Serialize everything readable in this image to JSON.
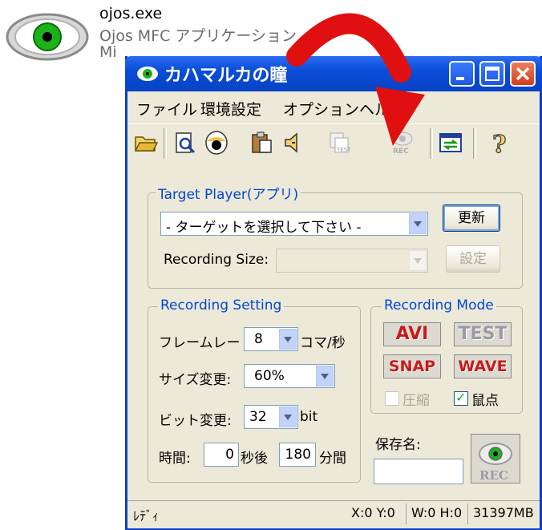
{
  "desktop_file": {
    "name": "ojos.exe",
    "description": "Ojos MFC アプリケーション",
    "company": "Mi",
    "icon": "eye-icon"
  },
  "window": {
    "title": "カハマルカの瞳",
    "title_icon": "eye-icon",
    "controls": [
      "minimize-icon",
      "maximize-icon",
      "close-icon"
    ]
  },
  "menu": {
    "items": [
      "ファイル",
      "環境設定",
      "オプション",
      "ヘルプ"
    ]
  },
  "toolbar": {
    "icons": [
      "open-folder-icon",
      "preview-icon",
      "eye-capture-icon",
      "clipboard-icon",
      "sound-icon",
      "test-icon",
      "rec-icon",
      "switch-window-icon",
      "help-icon"
    ]
  },
  "target_player": {
    "title": "Target Player(アプリ)",
    "target_select": "- ターゲットを選択して下さい -",
    "refresh_button": "更新",
    "recording_size_label": "Recording Size:",
    "recording_size_value": "",
    "settings_button": "設定"
  },
  "recording_setting": {
    "title": "Recording Setting",
    "framerate_label": "フレームレート:",
    "framerate_value": "8",
    "framerate_unit": "コマ/秒",
    "size_label": "サイズ変更:",
    "size_value": "60%",
    "bit_label": "ビット変更:",
    "bit_value": "32",
    "bit_unit": "bit",
    "time_label": "時間:",
    "delay_value": "0",
    "delay_unit": "秒後",
    "duration_value": "180",
    "duration_unit": "分間"
  },
  "recording_mode": {
    "title": "Recording Mode",
    "avi_label": "AVI",
    "test_label": "TEST",
    "snap_label": "SNAP",
    "wave_label": "WAVE",
    "compress_label": "圧縮",
    "compress_checked": false,
    "cursor_label": "鼠点",
    "cursor_checked": true
  },
  "save": {
    "label": "保存名:",
    "value": "",
    "rec_label": "REC"
  },
  "status": {
    "ready": "ﾚﾃﾞｨ",
    "xy": "X:0 Y:0",
    "wh": "W:0  H:0",
    "memory": "31397MB"
  },
  "colors": {
    "titlebar": "#0a4ed8",
    "group_title": "#0046d5",
    "accent_red": "#e01010"
  }
}
